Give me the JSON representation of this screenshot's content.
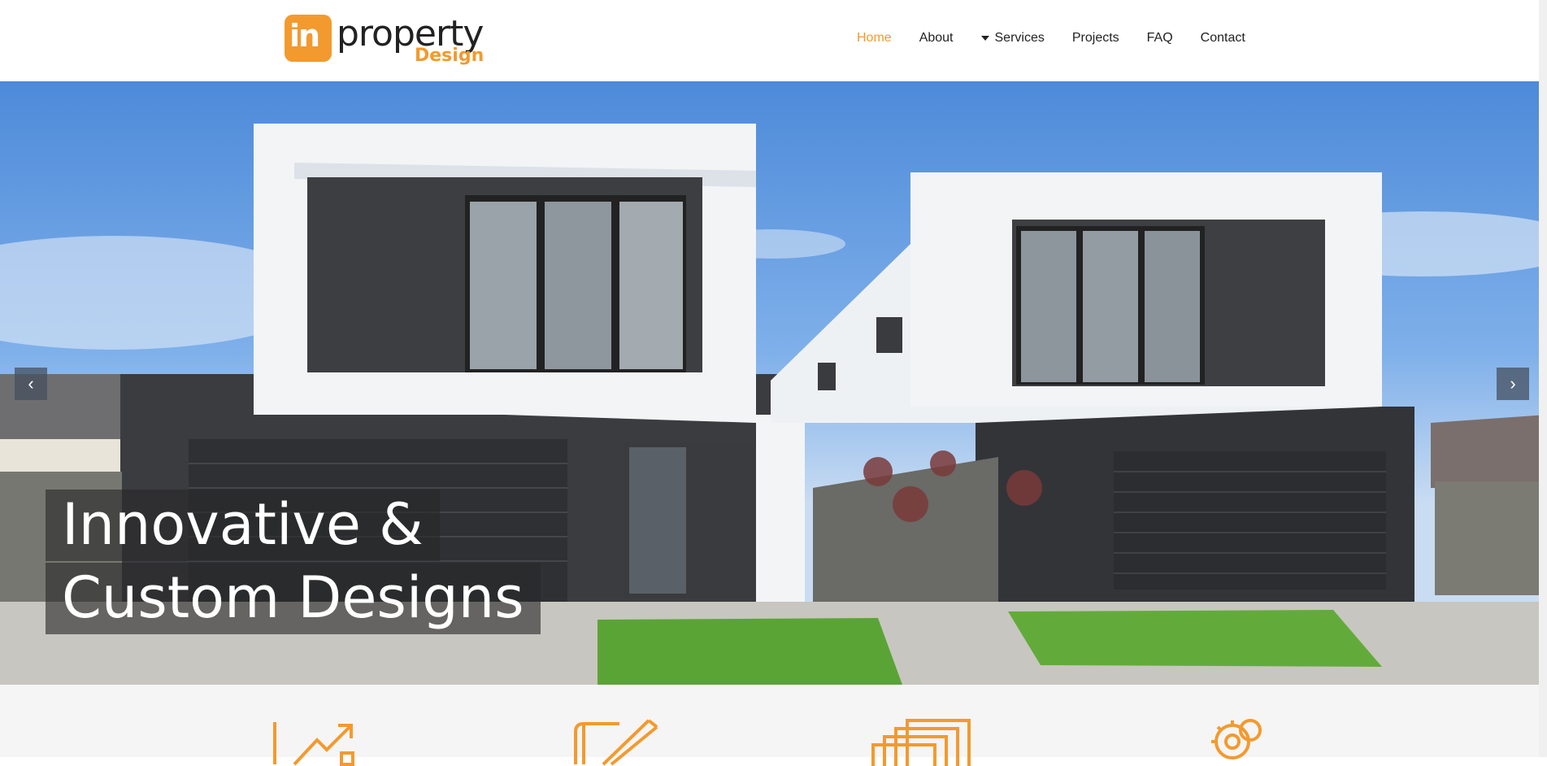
{
  "brand": {
    "mark": "in",
    "word": "property",
    "sub": "Design",
    "accent": "#f39a2e"
  },
  "nav": {
    "items": [
      {
        "label": "Home",
        "active": true
      },
      {
        "label": "About",
        "active": false
      },
      {
        "label": "Services",
        "active": false,
        "has_dropdown": true
      },
      {
        "label": "Projects",
        "active": false
      },
      {
        "label": "FAQ",
        "active": false
      },
      {
        "label": "Contact",
        "active": false
      }
    ]
  },
  "hero": {
    "headline_line1": "Innovative &",
    "headline_line2": "Custom Designs",
    "prev_icon": "‹",
    "next_icon": "›"
  },
  "features": {
    "icons": [
      "growth-chart-icon",
      "blueprint-pencil-icon",
      "documents-stack-icon",
      "gear-icon"
    ]
  }
}
